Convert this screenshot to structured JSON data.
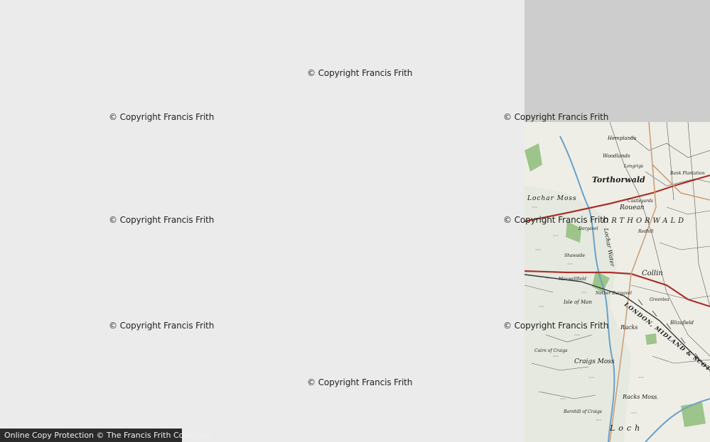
{
  "watermark": "© Copyright Francis Frith",
  "footer": {
    "label": "Online Copy Protection © The Francis Frith Collection"
  },
  "map": {
    "places": {
      "torthorwald": "Torthorwald",
      "rouean": "Rouean",
      "collin": "Collin",
      "lochar_moss": "Lochar Moss",
      "craigs_moss": "Craigs Moss",
      "racks_moss": "Racks Moss",
      "woodlands": "Woodlands",
      "hemplands": "Hemplands",
      "longrigs": "Longrigs",
      "bank_plantation": "Bank Plantation",
      "castleyards": "Castleyards",
      "maxwellfield": "Maxwellfield",
      "nether_dargavel": "Nether Dargavel",
      "blizafield": "Blizafield",
      "racks": "Racks",
      "isle_of_man": "Isle of Man",
      "dargavel": "Dargavel",
      "redhill": "Redhill",
      "shawside": "Shawside",
      "roucan_parish": "ORTHORWALD",
      "railway": "LONDON, MIDLAND & SCOTTISH",
      "kirkton": "Cairn of Craigs",
      "barnhill": "Barnhill of Craigs",
      "greenlea": "Greenlea",
      "lochar_water": "Lochar Water",
      "loch": "Loch"
    }
  }
}
